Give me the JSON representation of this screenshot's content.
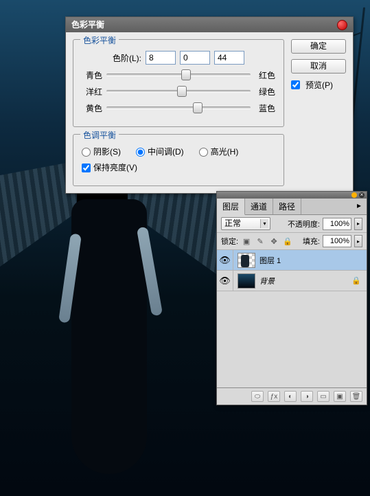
{
  "colorBalance": {
    "title": "色彩平衡",
    "group1Title": "色彩平衡",
    "levelsLabel": "色阶(L):",
    "values": [
      "8",
      "0",
      "44"
    ],
    "sliders": [
      {
        "left": "青色",
        "right": "红色",
        "pos": 52
      },
      {
        "left": "洋红",
        "right": "绿色",
        "pos": 49
      },
      {
        "left": "黄色",
        "right": "蓝色",
        "pos": 60
      }
    ],
    "group2Title": "色调平衡",
    "radios": {
      "shadow": "阴影(S)",
      "mid": "中间调(D)",
      "high": "高光(H)"
    },
    "preserve": "保持亮度(V)",
    "ok": "确定",
    "cancel": "取消",
    "preview": "预览(P)"
  },
  "layers": {
    "tabs": [
      "图层",
      "通道",
      "路径"
    ],
    "blendMode": "正常",
    "opacityLabel": "不透明度:",
    "opacityValue": "100%",
    "lockLabel": "锁定:",
    "fillLabel": "填充:",
    "fillValue": "100%",
    "items": [
      {
        "name": "图层 1",
        "locked": false,
        "selected": true
      },
      {
        "name": "背景",
        "locked": true,
        "selected": false
      }
    ]
  }
}
